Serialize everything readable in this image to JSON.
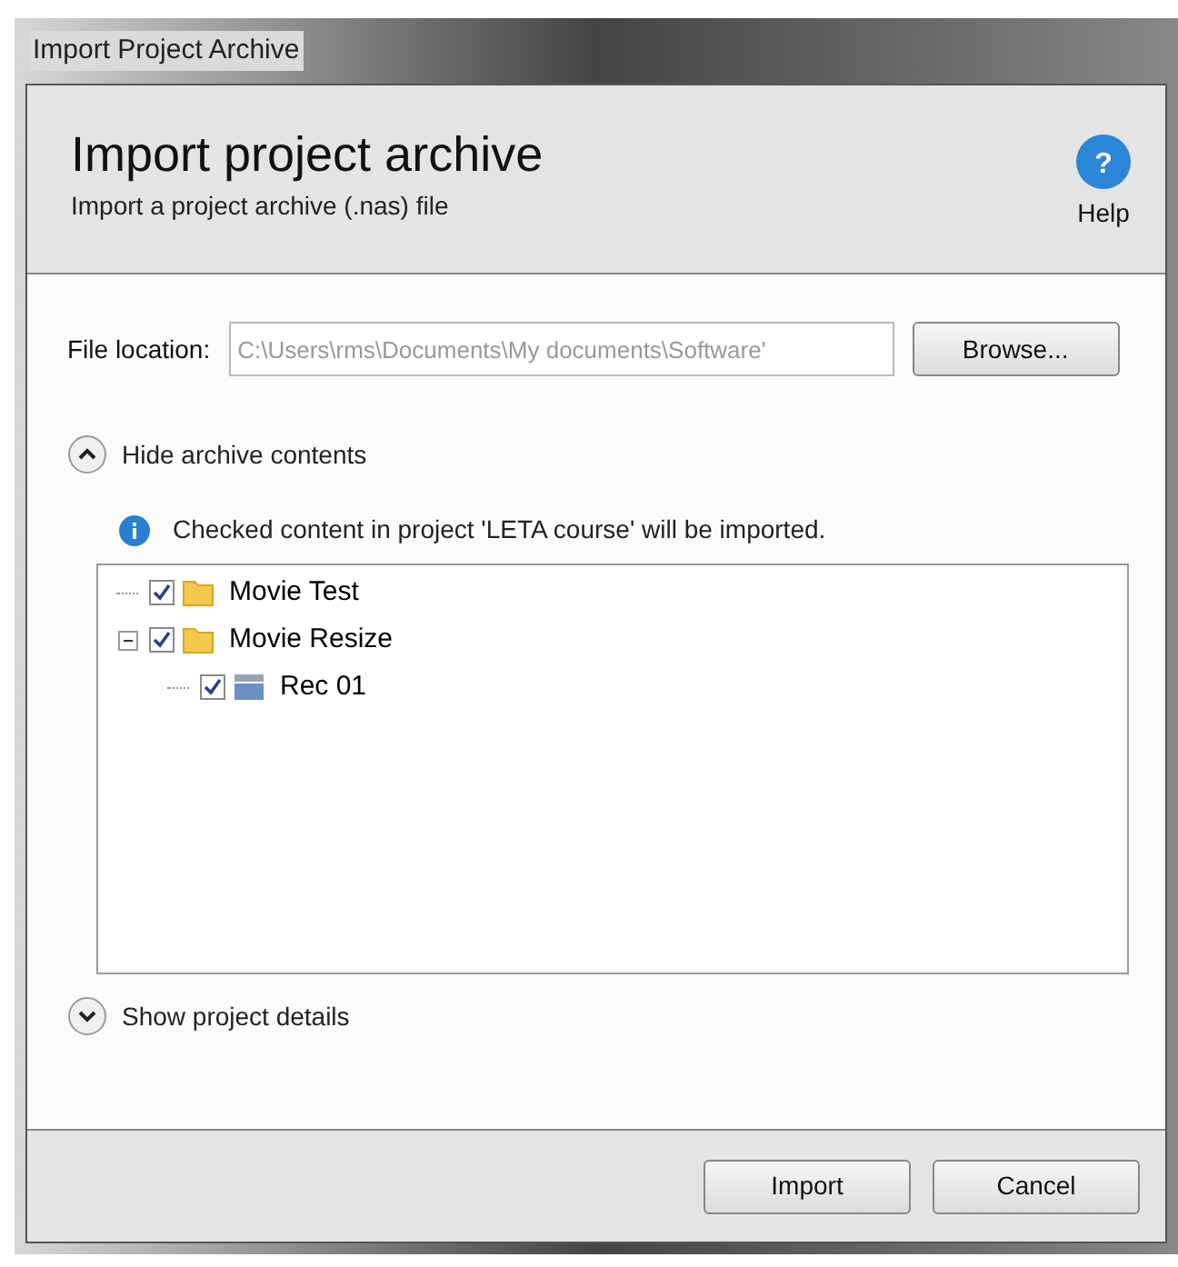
{
  "window": {
    "title": "Import Project Archive"
  },
  "header": {
    "title": "Import project archive",
    "subtitle": "Import a project archive (.nas) file",
    "help_icon_text": "?",
    "help_label": "Help"
  },
  "file_location": {
    "label": "File location:",
    "value": "C:\\Users\\rms\\Documents\\My documents\\Software'",
    "disabled": true,
    "browse_button": "Browse..."
  },
  "archive_section": {
    "toggle_label": "Hide archive contents",
    "expanded": true,
    "info": "Checked content in project 'LETA course' will be imported.",
    "tree": [
      {
        "label": "Movie Test",
        "kind": "folder",
        "checked": true
      },
      {
        "label": "Movie Resize",
        "kind": "folder",
        "checked": true,
        "expanded": true,
        "children": [
          {
            "label": "Rec 01",
            "kind": "recording",
            "checked": true
          }
        ]
      }
    ]
  },
  "details_section": {
    "toggle_label": "Show project details",
    "expanded": false
  },
  "buttons": [
    "Import",
    "Cancel"
  ]
}
